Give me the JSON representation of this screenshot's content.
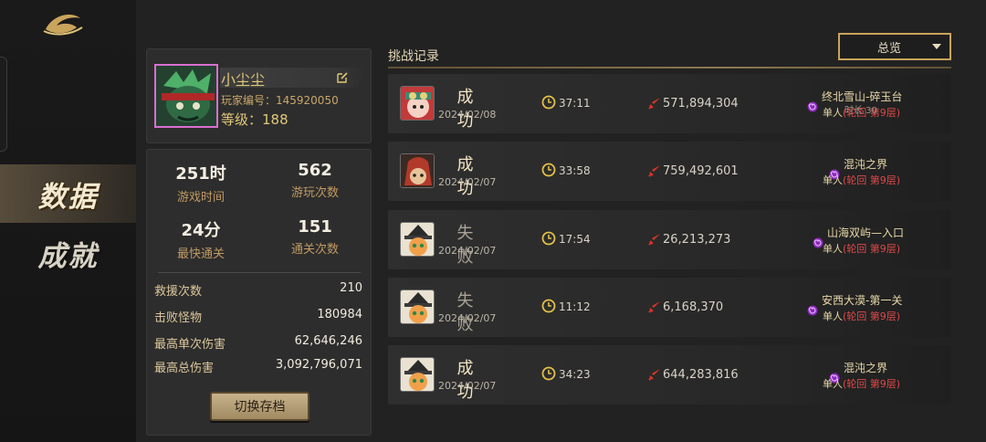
{
  "nav": {
    "items": [
      {
        "label": "数据",
        "active": true
      },
      {
        "label": "成就",
        "active": false
      }
    ]
  },
  "profile": {
    "name": "小尘尘",
    "id_text": "玩家编号：145920050",
    "level_text": "等级：188"
  },
  "stats": {
    "top": [
      {
        "value": "251时",
        "label": "游戏时间"
      },
      {
        "value": "562",
        "label": "游玩次数"
      },
      {
        "value": "24分",
        "label": "最快通关"
      },
      {
        "value": "151",
        "label": "通关次数"
      }
    ],
    "rows": [
      {
        "label": "救援次数",
        "value": "210"
      },
      {
        "label": "击败怪物",
        "value": "180984"
      },
      {
        "label": "最高单次伤害",
        "value": "62,646,246"
      },
      {
        "label": "最高总伤害",
        "value": "3,092,796,071"
      }
    ],
    "switch_label": "切换存档"
  },
  "records": {
    "title": "挑战记录",
    "filter": "总览",
    "items": [
      {
        "result": "成 功",
        "outcome": "win",
        "date": "2024/02/08",
        "time": "37:11",
        "damage": "571,894,304",
        "stage": "终北雪山-碎玉台",
        "mode_a": "单人",
        "mode_b": "(轮回  第9层)",
        "overlay": "时长 30",
        "avatar": "red"
      },
      {
        "result": "成 功",
        "outcome": "win",
        "date": "2024/02/07",
        "time": "33:58",
        "damage": "759,492,601",
        "stage": "混沌之界",
        "mode_a": "单人",
        "mode_b": "(轮回  第9层)",
        "overlay": "",
        "avatar": "hood"
      },
      {
        "result": "失 败",
        "outcome": "lose",
        "date": "2024/02/07",
        "time": "17:54",
        "damage": "26,213,273",
        "stage": "山海双屿—入口",
        "mode_a": "单人",
        "mode_b": "(轮回  第9层)",
        "overlay": "",
        "avatar": "cat"
      },
      {
        "result": "失 败",
        "outcome": "lose",
        "date": "2024/02/07",
        "time": "11:12",
        "damage": "6,168,370",
        "stage": "安西大漠-第一关",
        "mode_a": "单人",
        "mode_b": "(轮回  第9层)",
        "overlay": "",
        "avatar": "cat"
      },
      {
        "result": "成 功",
        "outcome": "win",
        "date": "2024/02/07",
        "time": "34:23",
        "damage": "644,283,816",
        "stage": "混沌之界",
        "mode_a": "单人",
        "mode_b": "(轮回  第9层)",
        "overlay": "",
        "avatar": "cat"
      }
    ]
  },
  "colors": {
    "accent_gold": "#c9a45c",
    "success_text": "#f2e5c4",
    "fail_text": "#a8a296",
    "mode_red": "#e04848",
    "stage_swirl": "#b03ad8"
  },
  "icons": [
    "logo-icon",
    "edit-icon",
    "clock-icon",
    "sword-icon",
    "swirl-icon",
    "chevron-down-icon"
  ]
}
